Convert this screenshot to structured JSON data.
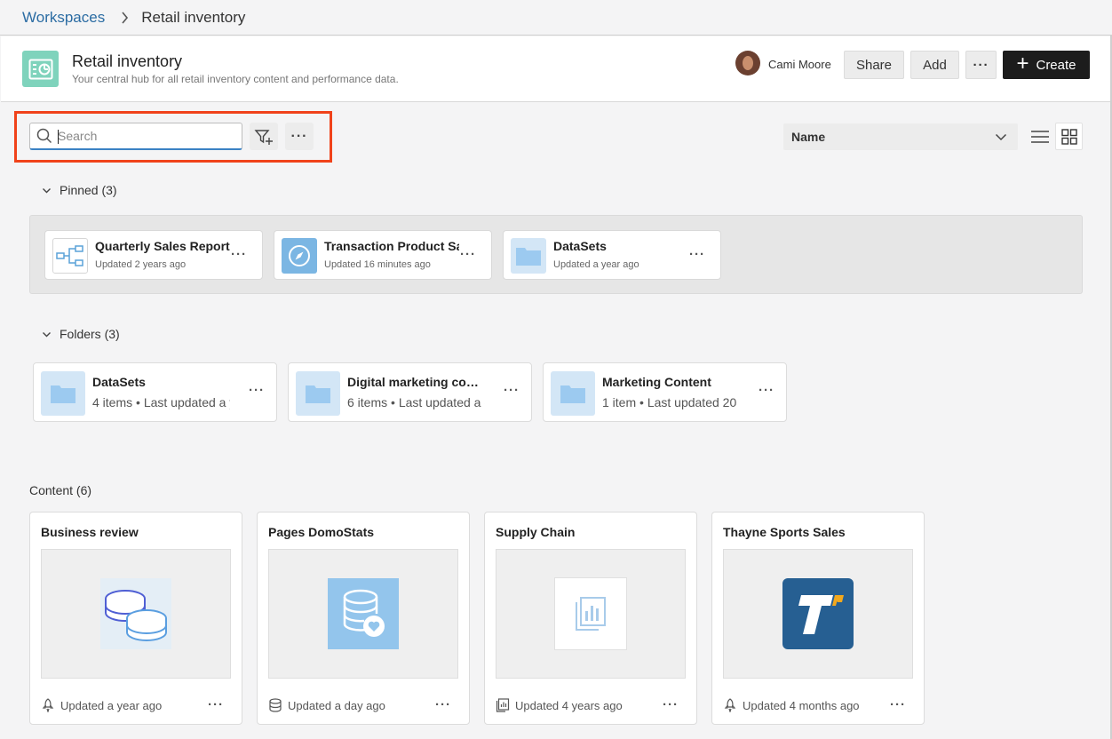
{
  "breadcrumb": {
    "root": "Workspaces",
    "current": "Retail inventory"
  },
  "header": {
    "title": "Retail inventory",
    "subtitle": "Your central hub for all retail inventory content and performance data.",
    "user_name": "Cami Moore",
    "share_label": "Share",
    "add_label": "Add",
    "more_label": "···",
    "create_label": "Create"
  },
  "toolbar": {
    "search_placeholder": "Search",
    "search_value": "",
    "more_label": "···",
    "sort_selected": "Name",
    "view_mode": "grid"
  },
  "pinned": {
    "title": "Pinned (3)",
    "items": [
      {
        "title": "Quarterly Sales Report",
        "subtitle": "Updated 2 years ago",
        "icon": "dataflow-icon"
      },
      {
        "title": "Transaction Product Sales",
        "subtitle": "Updated 16 minutes ago",
        "icon": "compass-icon"
      },
      {
        "title": "DataSets",
        "subtitle": "Updated a year ago",
        "icon": "folder-icon"
      }
    ]
  },
  "folders": {
    "title": "Folders (3)",
    "items": [
      {
        "title": "DataSets",
        "count": "4 items",
        "updated": "Last updated a year ago"
      },
      {
        "title": "Digital marketing content",
        "count": "6 items",
        "updated": "Last updated a day ago"
      },
      {
        "title": "Marketing Content",
        "count": "1 item",
        "updated": "Last updated 20"
      }
    ]
  },
  "content": {
    "title": "Content (6)",
    "items": [
      {
        "title": "Business review",
        "updated": "Updated a year ago",
        "icon": "rocket-icon",
        "thumb": "coins-thumbnail"
      },
      {
        "title": "Pages DomoStats",
        "updated": "Updated a day ago",
        "icon": "database-icon",
        "thumb": "database-heart-thumbnail"
      },
      {
        "title": "Supply Chain",
        "updated": "Updated 4 years ago",
        "icon": "report-icon",
        "thumb": "report-thumbnail"
      },
      {
        "title": "Thayne Sports Sales",
        "updated": "Updated 4 months ago",
        "icon": "rocket-icon",
        "thumb": "thayne-logo-thumbnail"
      }
    ]
  },
  "colors": {
    "accent_blue": "#2b6ca3",
    "highlight_red": "#f0421a",
    "workspace_icon": "#7fd3bc",
    "create_button": "#1c1c1c",
    "folder_blue": "#d3e6f6"
  }
}
